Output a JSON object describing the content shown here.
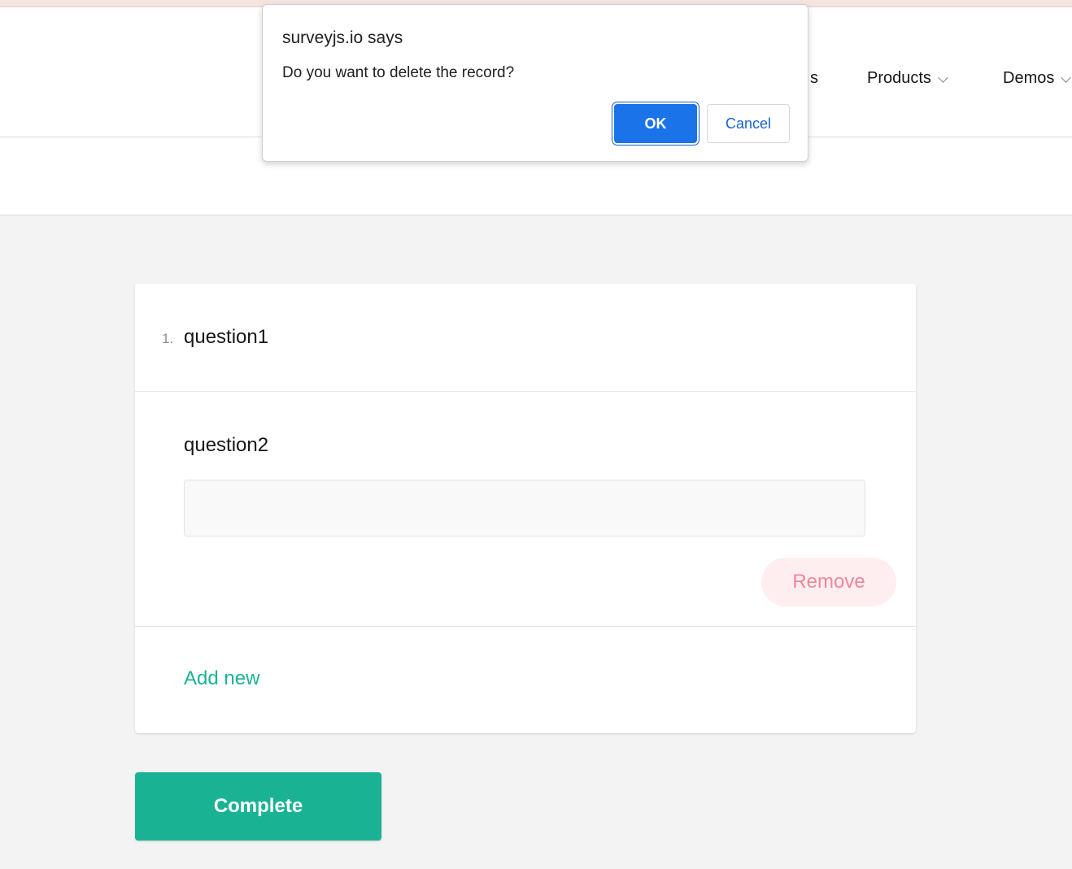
{
  "nav": {
    "partial_label": "s",
    "products_label": "Products",
    "demos_label": "Demos"
  },
  "survey": {
    "q1": {
      "number": "1.",
      "title": "question1"
    },
    "q2": {
      "title": "question2",
      "value": ""
    },
    "remove_label": "Remove",
    "add_new_label": "Add new",
    "complete_label": "Complete"
  },
  "dialog": {
    "title": "surveyjs.io says",
    "message": "Do you want to delete the record?",
    "ok_label": "OK",
    "cancel_label": "Cancel"
  },
  "colors": {
    "accent": "#19b394",
    "remove_text": "#f0869a",
    "remove_bg": "#ffeef0",
    "dialog_ok": "#1a73e8"
  },
  "icons": {
    "nav_dropdown": "chevron-down-icon"
  }
}
